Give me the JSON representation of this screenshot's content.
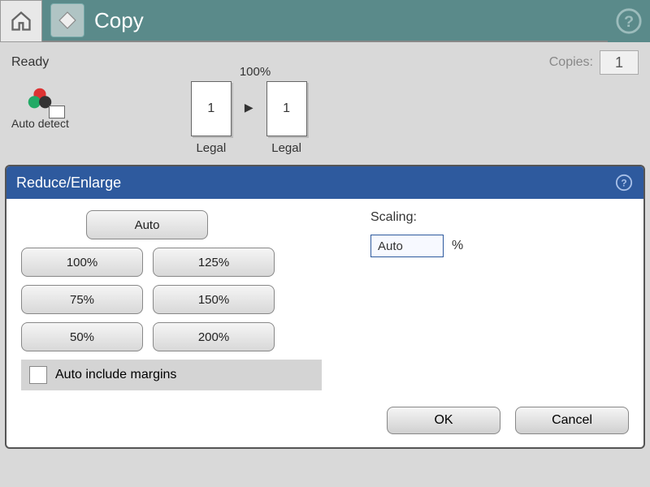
{
  "topbar": {
    "title": "Copy"
  },
  "status": {
    "ready_label": "Ready",
    "copies_label": "Copies:",
    "copies_value": "1"
  },
  "preview": {
    "auto_detect_label": "Auto detect",
    "scale_percent": "100%",
    "source": {
      "number": "1",
      "size_label": "Legal"
    },
    "target": {
      "number": "1",
      "size_label": "Legal"
    }
  },
  "dialog": {
    "title": "Reduce/Enlarge",
    "presets": {
      "auto": "Auto",
      "p100": "100%",
      "p125": "125%",
      "p75": "75%",
      "p150": "150%",
      "p50": "50%",
      "p200": "200%"
    },
    "auto_margins_label": "Auto include margins",
    "auto_margins_checked": false,
    "scaling_label": "Scaling:",
    "scaling_value": "Auto",
    "scaling_unit": "%",
    "ok_label": "OK",
    "cancel_label": "Cancel"
  }
}
